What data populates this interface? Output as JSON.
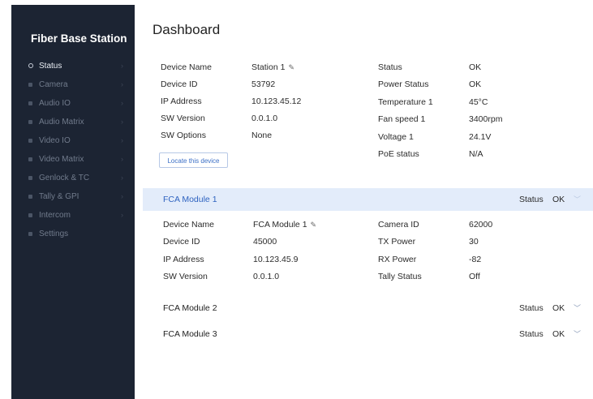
{
  "sidebar": {
    "title": "Fiber Base Station",
    "items": [
      {
        "label": "Status",
        "active": true,
        "chevron": true,
        "icon": "status-icon"
      },
      {
        "label": "Camera",
        "active": false,
        "chevron": true,
        "icon": "camera-icon"
      },
      {
        "label": "Audio IO",
        "active": false,
        "chevron": true,
        "icon": "audio-io-icon"
      },
      {
        "label": "Audio Matrix",
        "active": false,
        "chevron": true,
        "icon": "audio-matrix-icon"
      },
      {
        "label": "Video IO",
        "active": false,
        "chevron": true,
        "icon": "video-io-icon"
      },
      {
        "label": "Video Matrix",
        "active": false,
        "chevron": true,
        "icon": "video-matrix-icon"
      },
      {
        "label": "Genlock & TC",
        "active": false,
        "chevron": true,
        "icon": "genlock-icon"
      },
      {
        "label": "Tally & GPI",
        "active": false,
        "chevron": true,
        "icon": "tally-icon"
      },
      {
        "label": "Intercom",
        "active": false,
        "chevron": true,
        "icon": "intercom-icon"
      },
      {
        "label": "Settings",
        "active": false,
        "chevron": false,
        "icon": "settings-icon"
      }
    ]
  },
  "main": {
    "title": "Dashboard",
    "device": {
      "left": [
        {
          "label": "Device Name",
          "value": "Station 1",
          "editable": true
        },
        {
          "label": "Device ID",
          "value": "53792"
        },
        {
          "label": "IP Address",
          "value": "10.123.45.12"
        },
        {
          "label": "SW Version",
          "value": "0.0.1.0"
        },
        {
          "label": "SW Options",
          "value": "None"
        }
      ],
      "right": [
        {
          "label": "Status",
          "value": "OK"
        },
        {
          "label": "Power Status",
          "value": "OK"
        },
        {
          "label": "Temperature 1",
          "value": "45°C"
        },
        {
          "label": "Fan speed 1",
          "value": "3400rpm"
        },
        {
          "label": "Voltage 1",
          "value": "24.1V"
        },
        {
          "label": "PoE status",
          "value": "N/A"
        }
      ],
      "locate_button": "Locate this device"
    },
    "modules": [
      {
        "name": "FCA Module 1",
        "status_label": "Status",
        "status": "OK",
        "expanded": true,
        "left": [
          {
            "label": "Device Name",
            "value": "FCA Module 1",
            "editable": true
          },
          {
            "label": "Device ID",
            "value": "45000"
          },
          {
            "label": "IP Address",
            "value": "10.123.45.9"
          },
          {
            "label": "SW Version",
            "value": "0.0.1.0"
          }
        ],
        "right": [
          {
            "label": "Camera ID",
            "value": "62000"
          },
          {
            "label": "TX Power",
            "value": "30"
          },
          {
            "label": "RX Power",
            "value": "-82"
          },
          {
            "label": "Tally Status",
            "value": "Off"
          }
        ]
      },
      {
        "name": "FCA Module 2",
        "status_label": "Status",
        "status": "OK",
        "expanded": false
      },
      {
        "name": "FCA Module 3",
        "status_label": "Status",
        "status": "OK",
        "expanded": false
      }
    ]
  },
  "icons": {
    "edit": "✎",
    "chevron_down": "﹀",
    "chevron_right": "›"
  },
  "colors": {
    "sidebar_bg": "#1c2433",
    "accent": "#2f63c0",
    "module_open_bg": "#e3ecfa"
  }
}
